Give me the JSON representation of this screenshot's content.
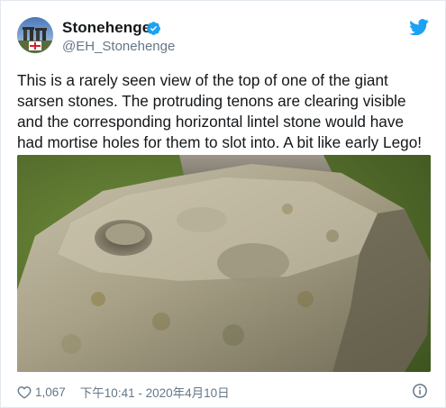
{
  "tweet": {
    "display_name": "Stonehenge",
    "handle": "@EH_Stonehenge",
    "text": "This is a rarely seen view of the top of one of the giant sarsen stones. The protruding tenons are clearing visible and the corresponding horizontal lintel stone would have had mortise holes for them to slot into. A bit like early Lego!",
    "like_count": "1,067",
    "timestamp": "下午10:41 - 2020年4月10日"
  },
  "icons": {
    "verified": "verified-badge-icon",
    "logo": "twitter-bird-icon",
    "like": "heart-icon",
    "info": "info-icon"
  },
  "colors": {
    "verified_blue": "#1da1f2",
    "secondary_text": "#657786",
    "primary_text": "#14171a"
  }
}
